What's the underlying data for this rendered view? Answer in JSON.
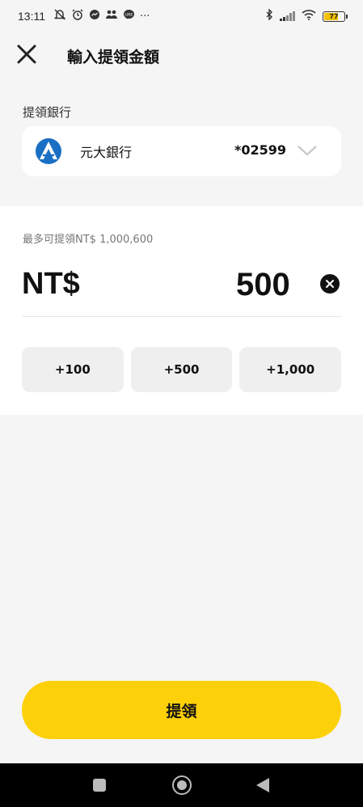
{
  "status_bar": {
    "time": "13:11",
    "more": "···",
    "battery": "77",
    "icons": [
      "mute-icon",
      "alarm-icon",
      "messenger-icon",
      "people-icon",
      "line-icon",
      "bluetooth-icon",
      "signal-icon",
      "wifi-icon",
      "battery-icon"
    ]
  },
  "header": {
    "title": "輸入提領金額",
    "close_icon": "close-icon"
  },
  "bank": {
    "label": "提領銀行",
    "name": "元大銀行",
    "account": "*02599",
    "logo_icon": "yuanta-bank-logo",
    "dropdown_icon": "chevron-down-icon"
  },
  "amount": {
    "max_note": "最多可提領NT$ 1,000,600",
    "currency": "NT$",
    "value": "500",
    "clear_icon": "clear-icon"
  },
  "quick_amounts": [
    "+100",
    "+500",
    "+1,000"
  ],
  "submit": {
    "label": "提領",
    "color": "#fdd10a"
  },
  "nav": {
    "icons": [
      "recents-icon",
      "home-icon",
      "back-icon"
    ]
  }
}
